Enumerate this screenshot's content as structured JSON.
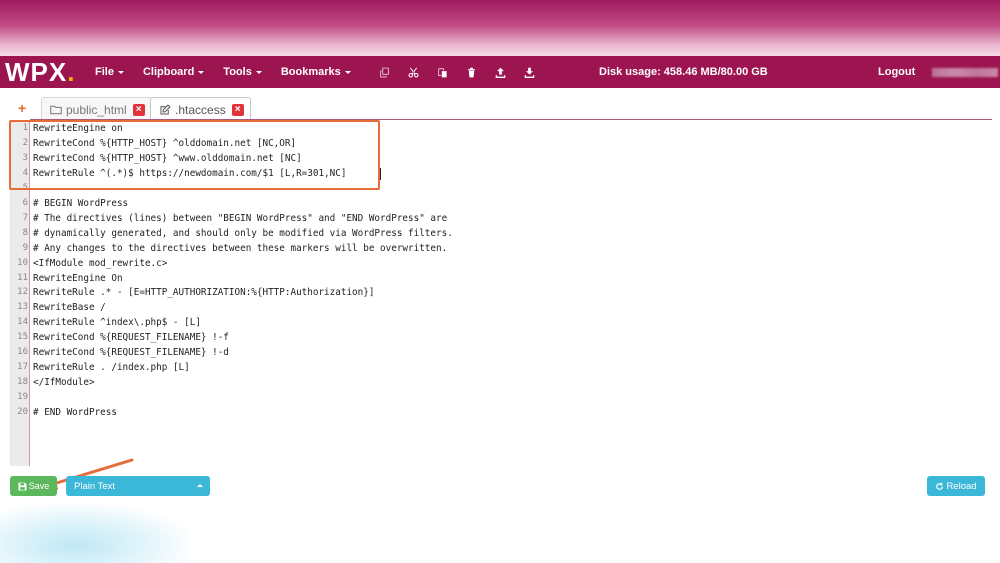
{
  "logo": {
    "text": "WPX",
    "dot": "."
  },
  "menu": [
    {
      "label": "File"
    },
    {
      "label": "Clipboard"
    },
    {
      "label": "Tools"
    },
    {
      "label": "Bookmarks"
    }
  ],
  "toolbar_icons": [
    "copy-icon",
    "cut-icon",
    "paste-icon",
    "trash-icon",
    "upload-icon",
    "download-icon"
  ],
  "disk_usage": "Disk usage: 458.46 MB/80.00 GB",
  "logout_label": "Logout",
  "tabs": [
    {
      "label": "public_html",
      "icon": "folder-icon",
      "active": false,
      "close": "×"
    },
    {
      "label": ".htaccess",
      "icon": "edit-icon",
      "active": true,
      "close": "×"
    }
  ],
  "add_tab": "+",
  "editor": {
    "lines": [
      "RewriteEngine on",
      "RewriteCond %{HTTP_HOST} ^olddomain.net [NC,OR]",
      "RewriteCond %{HTTP_HOST} ^www.olddomain.net [NC]",
      "RewriteRule ^(.*)$ https://newdomain.com/$1 [L,R=301,NC]",
      "",
      "# BEGIN WordPress",
      "# The directives (lines) between \"BEGIN WordPress\" and \"END WordPress\" are",
      "# dynamically generated, and should only be modified via WordPress filters.",
      "# Any changes to the directives between these markers will be overwritten.",
      "<IfModule mod_rewrite.c>",
      "RewriteEngine On",
      "RewriteRule .* - [E=HTTP_AUTHORIZATION:%{HTTP:Authorization}]",
      "RewriteBase /",
      "RewriteRule ^index\\.php$ - [L]",
      "RewriteCond %{REQUEST_FILENAME} !-f",
      "RewriteCond %{REQUEST_FILENAME} !-d",
      "RewriteRule . /index.php [L]",
      "</IfModule>",
      "",
      "# END WordPress"
    ]
  },
  "bottom": {
    "save_label": "Save",
    "mode_label": "Plain Text",
    "reload_label": "Reload"
  },
  "colors": {
    "brand": "#9c1550",
    "accent": "#f5b300",
    "highlight": "#e86b3a",
    "save": "#5cb85c",
    "info": "#3bb7d8",
    "close": "#e0343c"
  }
}
